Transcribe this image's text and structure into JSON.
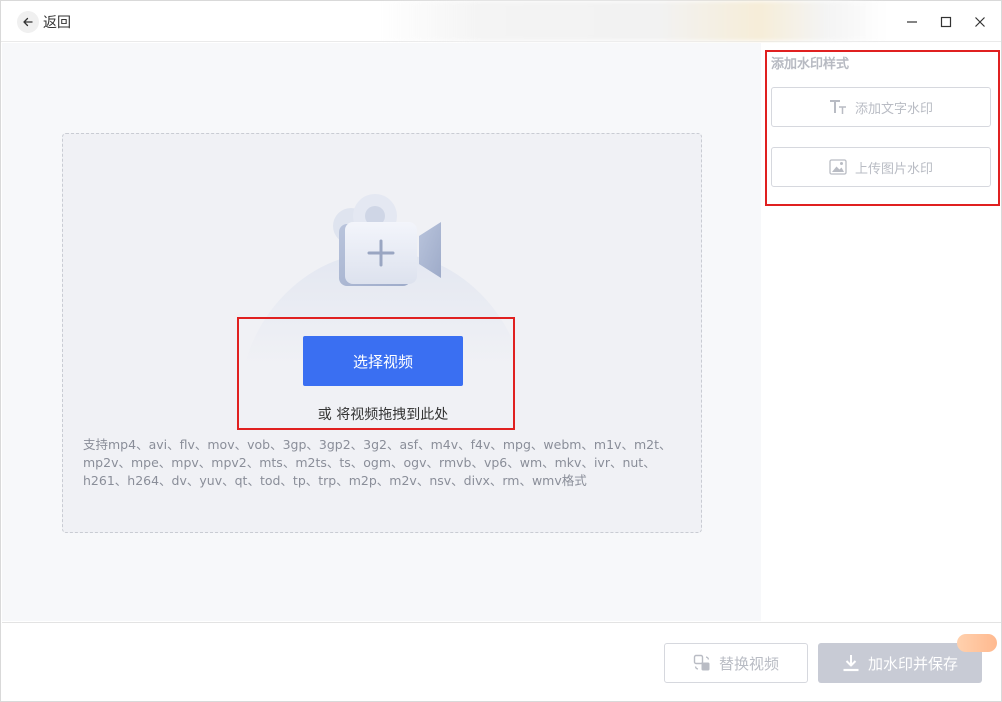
{
  "titlebar": {
    "back_label": "返回"
  },
  "dropzone": {
    "select_button": "选择视频",
    "drag_hint": "或 将视频拖拽到此处",
    "formats_text": "支持mp4、avi、flv、mov、vob、3gp、3gp2、3g2、asf、m4v、f4v、mpg、webm、m1v、m2t、mp2v、mpe、mpv、mpv2、mts、m2ts、ts、ogm、ogv、rmvb、vp6、wm、mkv、ivr、nut、h261、h264、dv、yuv、qt、tod、tp、trp、m2p、m2v、nsv、divx、rm、wmv格式"
  },
  "sidebar": {
    "title": "添加水印样式",
    "add_text_watermark": "添加文字水印",
    "upload_image_watermark": "上传图片水印"
  },
  "footer": {
    "replace_label": "替换视频",
    "save_label": "加水印并保存"
  },
  "colors": {
    "primary": "#3a6ff2",
    "highlight": "#e02020",
    "disabled": "#c8cbd5"
  }
}
